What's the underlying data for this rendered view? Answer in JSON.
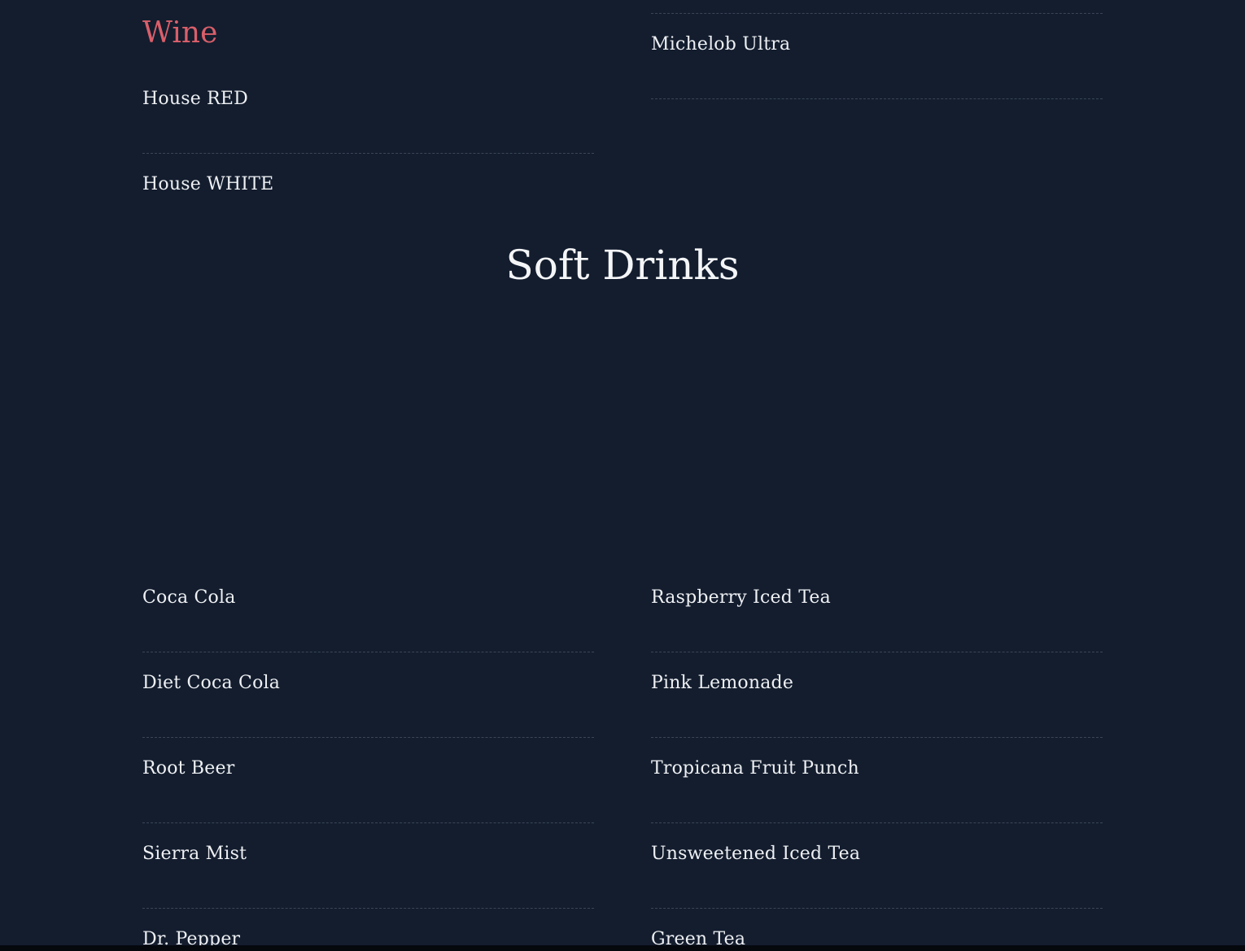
{
  "wine": {
    "heading": "Wine",
    "items": [
      "House RED",
      "House WHITE"
    ]
  },
  "beer": {
    "items": [
      "Michelob Ultra"
    ]
  },
  "soft_drinks": {
    "title": "Soft Drinks",
    "left_items": [
      "Coca Cola",
      "Diet Coca Cola",
      "Root Beer",
      "Sierra Mist",
      "Dr. Pepper"
    ],
    "right_items": [
      "Raspberry Iced Tea",
      "Pink Lemonade",
      "Tropicana Fruit Punch",
      "Unsweetened Iced Tea",
      "Green Tea"
    ]
  },
  "colors": {
    "background": "#131d2e",
    "accent": "#d95f6a",
    "text": "#eef0f3",
    "divider": "#3a4557"
  }
}
